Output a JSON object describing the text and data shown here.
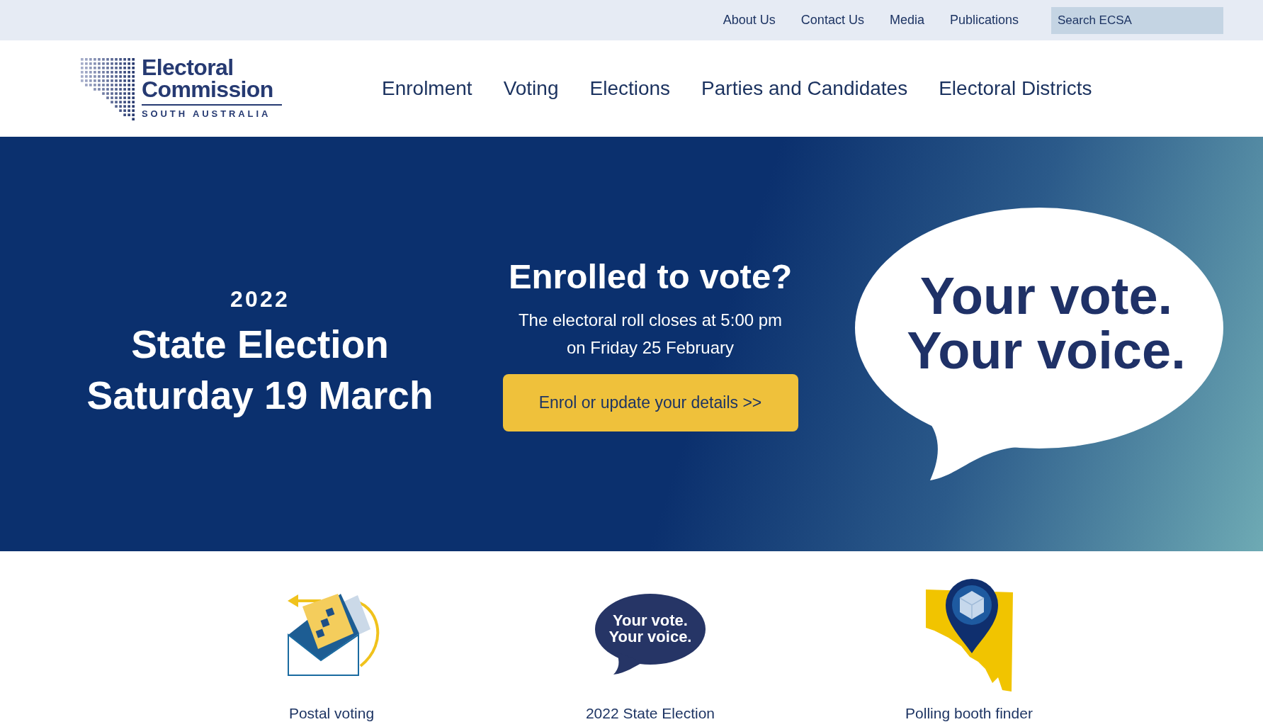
{
  "top_bar": {
    "links": [
      "About Us",
      "Contact Us",
      "Media",
      "Publications"
    ],
    "search": {
      "placeholder": "Search ECSA"
    }
  },
  "header": {
    "logo": {
      "lines": [
        "Electoral",
        "Commission"
      ],
      "tagline": "SOUTH AUSTRALIA"
    },
    "nav": [
      "Enrolment",
      "Voting",
      "Elections",
      "Parties and Candidates",
      "Electoral Districts"
    ]
  },
  "hero": {
    "event": {
      "year": "2022",
      "title": "State Election",
      "date": "Saturday 19 March"
    },
    "enrol": {
      "heading": "Enrolled to vote?",
      "text_lines": [
        "The electoral roll closes at 5:00 pm",
        "on Friday 25 February"
      ],
      "button": "Enrol or update your details >>"
    },
    "slogan": [
      "Your vote.",
      "Your voice."
    ]
  },
  "quick_links": [
    {
      "kind": "postal",
      "label": "Postal voting"
    },
    {
      "kind": "bubble",
      "label": "2022 State Election",
      "icon_text": [
        "Your vote.",
        "Your voice."
      ]
    },
    {
      "kind": "map",
      "label": "Polling booth finder"
    }
  ]
}
